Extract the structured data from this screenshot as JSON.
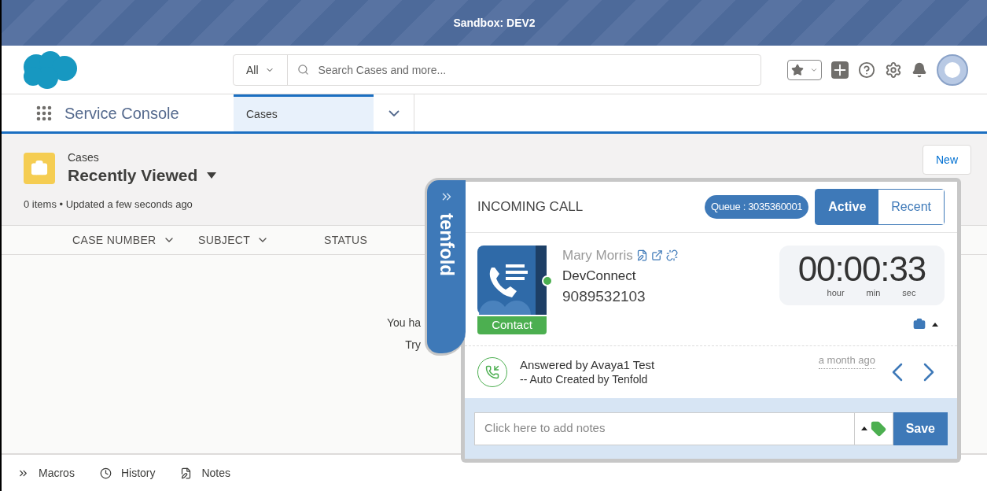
{
  "banner": {
    "title": "Sandbox: DEV2"
  },
  "search": {
    "scope": "All",
    "placeholder": "Search Cases and more..."
  },
  "nav": {
    "app_name": "Service Console",
    "tabs": [
      {
        "label": "Cases",
        "selected": true
      }
    ]
  },
  "list_view": {
    "object": "Cases",
    "title": "Recently Viewed",
    "meta": "0 items • Updated a few seconds ago",
    "new_button": "New",
    "columns": [
      "CASE NUMBER",
      "SUBJECT",
      "STATUS"
    ],
    "empty_lines": [
      "You ha",
      "Try"
    ]
  },
  "widget": {
    "brand": "tenfold",
    "heading": "INCOMING CALL",
    "queue": "Queue : 3035360001",
    "tabs": [
      {
        "label": "Active",
        "selected": true
      },
      {
        "label": "Recent",
        "selected": false
      }
    ],
    "contact": {
      "name": "Mary Morris",
      "company": "DevConnect",
      "phone": "9089532103",
      "badge": "Contact",
      "online": true
    },
    "timer": {
      "value": "00:00:33",
      "units": [
        "hour",
        "min",
        "sec"
      ]
    },
    "activity": {
      "line1": "Answered by Avaya1 Test",
      "line2": "-- Auto Created by Tenfold",
      "time": "a month ago"
    },
    "notes": {
      "placeholder": "Click here to add notes",
      "save": "Save"
    }
  },
  "utility_bar": [
    "Macros",
    "History",
    "Notes"
  ]
}
